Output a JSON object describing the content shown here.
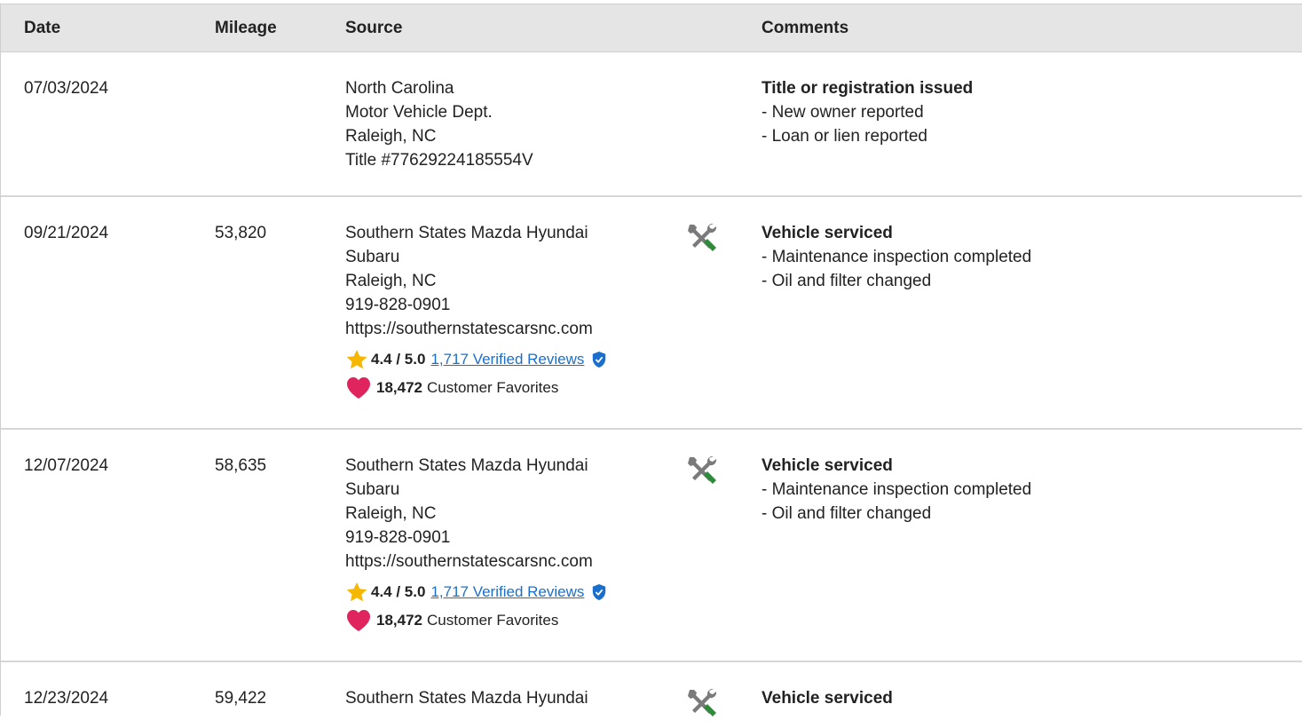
{
  "header": {
    "date": "Date",
    "mileage": "Mileage",
    "source": "Source",
    "comments": "Comments"
  },
  "rows": [
    {
      "date": "07/03/2024",
      "mileage": "",
      "source": [
        "North Carolina",
        "Motor Vehicle Dept.",
        "Raleigh, NC",
        "Title #77629224185554V"
      ],
      "icon": "",
      "comment_title": "Title or registration issued",
      "comment_items": [
        "- New owner reported",
        "- Loan or lien reported"
      ]
    },
    {
      "date": "09/21/2024",
      "mileage": "53,820",
      "source": [
        "Southern States Mazda Hyundai",
        "Subaru",
        "Raleigh, NC",
        "919-828-0901",
        "https://southernstatescarsnc.com"
      ],
      "rating_score": "4.4 / 5.0",
      "rating_link": "1,717 Verified Reviews",
      "favorites_count": "18,472",
      "favorites_label": "Customer Favorites",
      "icon": "wrench-screwdriver-icon",
      "comment_title": "Vehicle serviced",
      "comment_items": [
        "- Maintenance inspection completed",
        "- Oil and filter changed"
      ]
    },
    {
      "date": "12/07/2024",
      "mileage": "58,635",
      "source": [
        "Southern States Mazda Hyundai",
        "Subaru",
        "Raleigh, NC",
        "919-828-0901",
        "https://southernstatescarsnc.com"
      ],
      "rating_score": "4.4 / 5.0",
      "rating_link": "1,717 Verified Reviews",
      "favorites_count": "18,472",
      "favorites_label": "Customer Favorites",
      "icon": "wrench-screwdriver-icon",
      "comment_title": "Vehicle serviced",
      "comment_items": [
        "- Maintenance inspection completed",
        "- Oil and filter changed"
      ]
    },
    {
      "date": "12/23/2024",
      "mileage": "59,422",
      "source": [
        "Southern States Mazda Hyundai"
      ],
      "icon": "wrench-screwdriver-icon",
      "comment_title": "Vehicle serviced",
      "comment_items": []
    }
  ],
  "colors": {
    "header_bg": "#e5e5e5",
    "link": "#1a6fcc",
    "star": "#f5b700",
    "heart": "#e0245e",
    "shield": "#1a6fcc",
    "tool_green": "#2e8b3a",
    "tool_gray": "#7a7a7a"
  }
}
